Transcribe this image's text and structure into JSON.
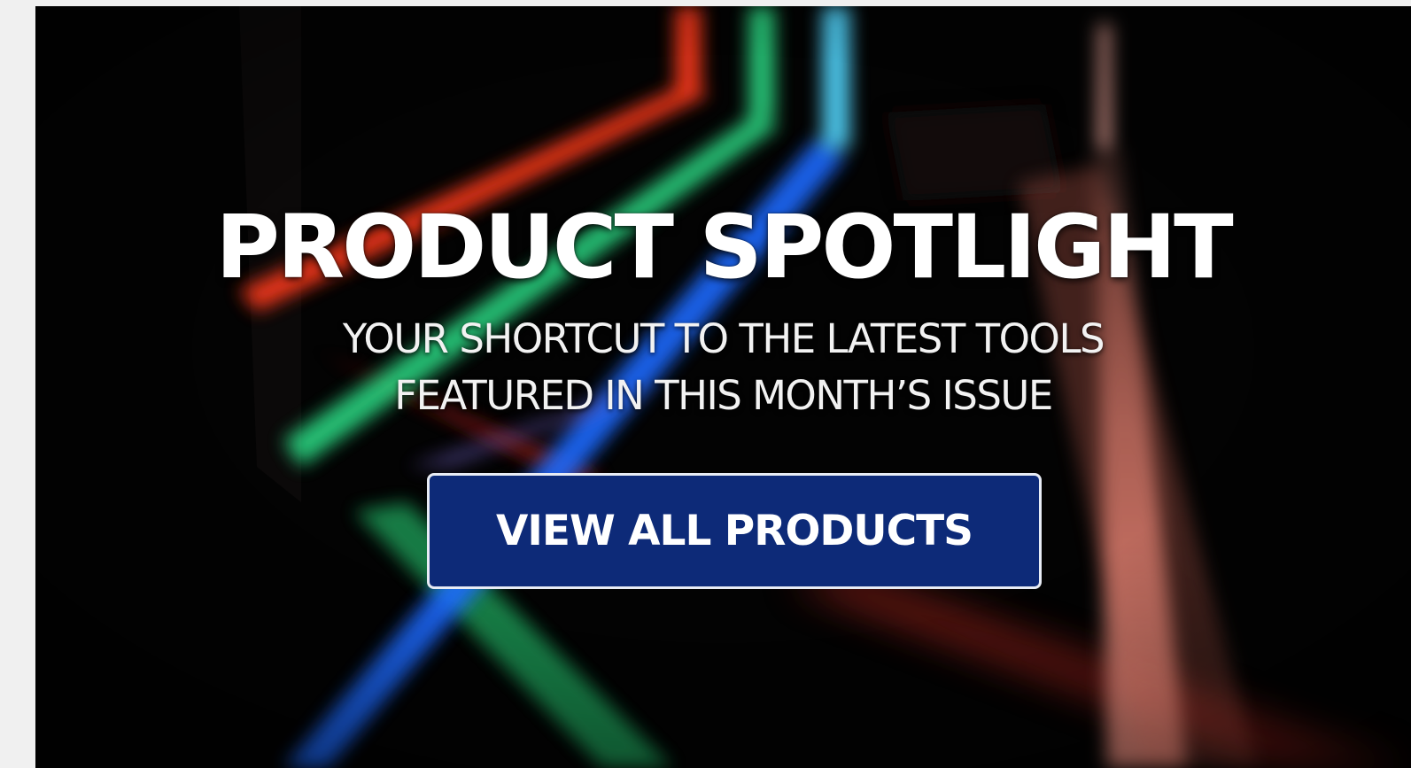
{
  "hero": {
    "title": "PRODUCT SPOTLIGHT",
    "subtitle_line1": "YOUR SHORTCUT TO THE LATEST TOOLS",
    "subtitle_line2": "FEATURED IN THIS MONTH’S ISSUE",
    "cta_label": "VIEW ALL PRODUCTS",
    "background_art": "colored-light-beams-photo"
  },
  "colors": {
    "page_background": "#f0f0f0",
    "hero_background": "#030303",
    "cta_background": "#0d2a78",
    "cta_border": "#e8ecf5",
    "text": "#ffffff",
    "beam_red": "#ff3b1e",
    "beam_green": "#2ee38a",
    "beam_blue": "#1d6bff",
    "beam_cyan": "#53d7ff",
    "beam_pink": "#ff9a8a"
  }
}
